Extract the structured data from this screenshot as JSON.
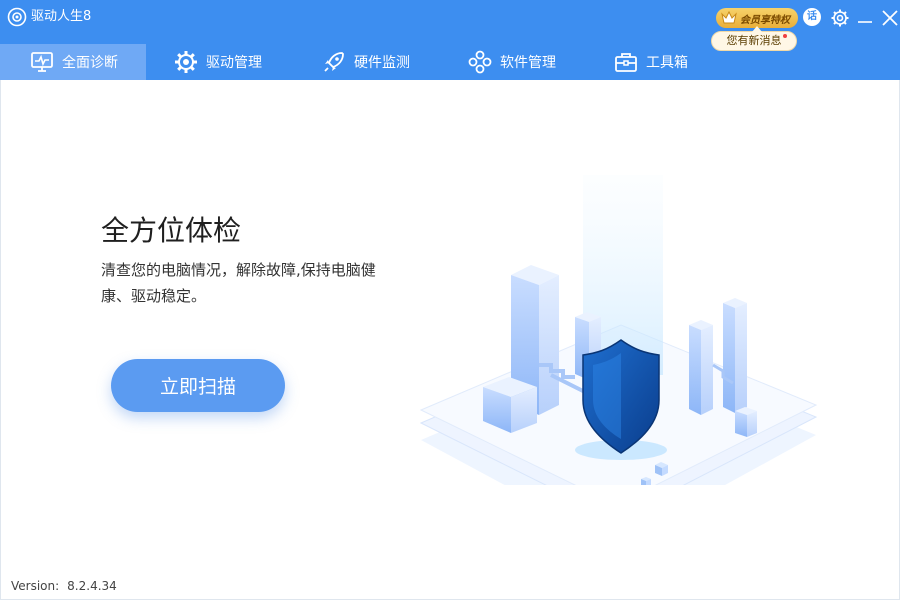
{
  "app": {
    "title": "驱动人生8"
  },
  "vip": {
    "label": "会员享特权"
  },
  "message": {
    "label": "您有新消息"
  },
  "titlebar": {
    "speech_glyph": "话"
  },
  "nav": {
    "tabs": [
      {
        "label": "全面诊断",
        "icon": "monitor-pulse-icon",
        "active": true
      },
      {
        "label": "驱动管理",
        "icon": "gear-icon",
        "active": false
      },
      {
        "label": "硬件监测",
        "icon": "rocket-icon",
        "active": false
      },
      {
        "label": "软件管理",
        "icon": "apps-icon",
        "active": false
      },
      {
        "label": "工具箱",
        "icon": "toolbox-icon",
        "active": false
      }
    ]
  },
  "main": {
    "headline": "全方位体检",
    "description": "清查您的电脑情况，解除故障,保持电脑健康、驱动稳定。",
    "scan_button": "立即扫描"
  },
  "footer": {
    "version_label": "Version:",
    "version_value": "8.2.4.34"
  },
  "colors": {
    "brand": "#3d8ef0",
    "active_tab": "#6fa9f5",
    "button": "#5b9bf1",
    "shield": "#0f4fa8"
  }
}
